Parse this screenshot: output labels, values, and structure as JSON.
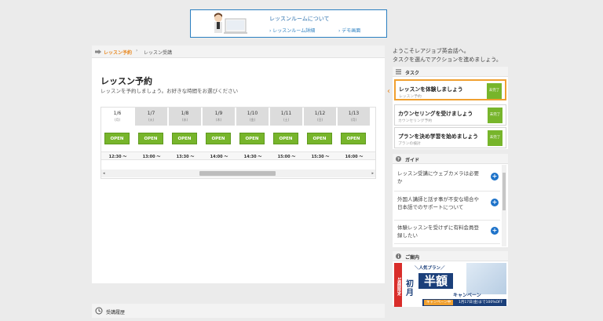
{
  "banner": {
    "title": "レッスンルームについて",
    "link1": "› レッスンルーム詳細",
    "link2": "› デモ画面"
  },
  "breadcrumb": {
    "current": "レッスン予約",
    "separator": "›",
    "next": "レッスン受講"
  },
  "page": {
    "title": "レッスン予約",
    "subtitle": "レッスンを予約しましょう。お好きな時間をお選びください"
  },
  "schedule": {
    "dates": [
      {
        "date": "1/6",
        "weekday": "(月)"
      },
      {
        "date": "1/7",
        "weekday": "(火)"
      },
      {
        "date": "1/8",
        "weekday": "(水)"
      },
      {
        "date": "1/9",
        "weekday": "(木)"
      },
      {
        "date": "1/10",
        "weekday": "(金)"
      },
      {
        "date": "1/11",
        "weekday": "(土)"
      },
      {
        "date": "1/12",
        "weekday": "(日)"
      },
      {
        "date": "1/13",
        "weekday": "(月)"
      }
    ],
    "slot_label": "OPEN",
    "times": [
      "12:30 〜",
      "13:00 〜",
      "13:30 〜",
      "14:00 〜",
      "14:30 〜",
      "15:00 〜",
      "15:30 〜",
      "16:00 〜"
    ],
    "scroll_left": "◂",
    "scroll_right": "▸"
  },
  "history": {
    "label": "受講履歴"
  },
  "sidebar": {
    "welcome_line1": "ようこそレアジョブ英会話へ。",
    "welcome_line2": "タスクを選んでアクションを進めましょう。",
    "tasks_header": "タスク",
    "task_caret": "‹",
    "tasks": [
      {
        "title": "レッスンを体験しましょう",
        "sub": "レッスン予約",
        "status": "未完了"
      },
      {
        "title": "カウンセリングを受けましょう",
        "sub": "カウンセリング予約",
        "status": "未完了"
      },
      {
        "title": "プランを決め学習を始めましょう",
        "sub": "プランの検討",
        "status": "未完了"
      }
    ],
    "guide_header": "ガイド",
    "guides": [
      {
        "text": "レッスン受講にウェブカメラは必要か"
      },
      {
        "text": "外国人講師と話す事が不安な場合や日本語でのサポートについて"
      },
      {
        "text": "体験レッスンを受けずに有料会員登録したい"
      }
    ],
    "info_header": "ご案内",
    "ad": {
      "flag": "1週間限定",
      "plan": "＼人気プラン／",
      "first": "初月",
      "half": "半額",
      "campaign": "キャンペーン",
      "tag": "キャンペーン中",
      "note": "1月17日(金)まで100%OFF"
    }
  }
}
